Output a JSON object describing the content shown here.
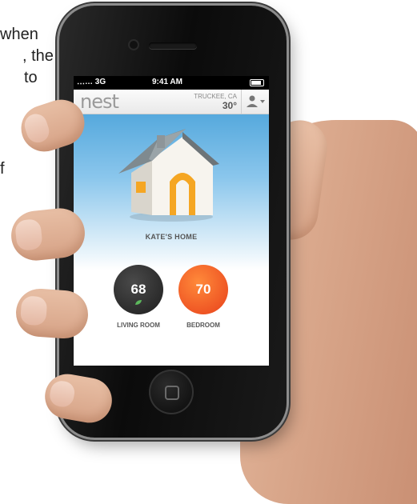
{
  "background_text": {
    "line1": "when",
    "line2": ", the",
    "line3": "to",
    "line4": "f"
  },
  "status_bar": {
    "signal": "․‥… 3G",
    "time": "9:41 AM"
  },
  "app_bar": {
    "logo": "nest",
    "location": "TRUCKEE, CA",
    "temperature": "30°"
  },
  "home": {
    "name": "KATE'S HOME"
  },
  "thermostats": [
    {
      "room": "LIVING ROOM",
      "temperature": "68",
      "color": "#2a2a2a",
      "leaf": true
    },
    {
      "room": "BEDROOM",
      "temperature": "70",
      "color": "#f0521f",
      "leaf": false
    }
  ],
  "icons": {
    "user": "user-icon",
    "dropdown": "chevron-down-icon",
    "house": "house-icon",
    "leaf": "leaf-icon",
    "home_button": "home-button-icon"
  },
  "colors": {
    "sky": "#56a9dd",
    "house_accent": "#f5a623",
    "heating": "#f0521f",
    "leaf": "#5cb85c"
  }
}
